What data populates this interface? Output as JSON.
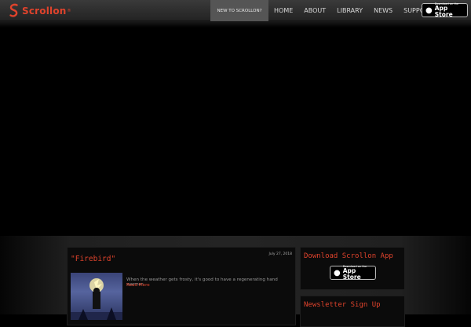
{
  "header": {
    "logo_text": "Scrollon",
    "logo_mark": "®",
    "nav": [
      {
        "label": "NEW TO SCROLLON?"
      },
      {
        "label": "HOME"
      },
      {
        "label": "ABOUT"
      },
      {
        "label": "LIBRARY"
      },
      {
        "label": "NEWS"
      },
      {
        "label": "SUPPORT"
      }
    ],
    "appstore": {
      "small": "Download on the",
      "big": "App Store"
    }
  },
  "post": {
    "title": "\"Firebird\"",
    "date": "July 27, 2018",
    "excerpt": "When the weather gets frosty, it's good to have a regenerating hand warmer.",
    "read_more": "Read More"
  },
  "sidebar": {
    "app_title": "Download Scrollon App",
    "appstore": {
      "small": "Download on the",
      "big": "App Store"
    },
    "newsletter_title": "Newsletter Sign Up"
  },
  "colors": {
    "accent": "#e0432c",
    "header_bg": "#2d2d2d",
    "nav_active": "#555555"
  }
}
